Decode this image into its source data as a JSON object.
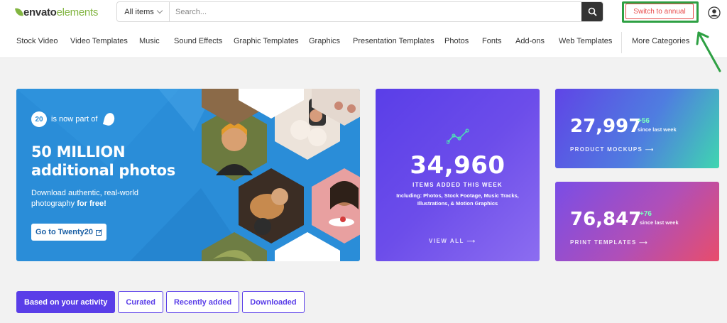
{
  "header": {
    "logo_brand": "envato",
    "logo_brand2": "elements",
    "search_category": "All items",
    "search_placeholder": "Search...",
    "annual_button": "Switch to annual"
  },
  "nav": {
    "items": [
      "Stock Video",
      "Video Templates",
      "Music",
      "Sound Effects",
      "Graphic Templates",
      "Graphics",
      "Presentation Templates",
      "Photos",
      "Fonts",
      "Add-ons",
      "Web Templates"
    ],
    "more": "More Categories"
  },
  "hero": {
    "badge": "20",
    "badge_text": "is now part of",
    "title_line1": "50 MILLION",
    "title_line2": "additional photos",
    "desc_line1": "Download authentic, real-world",
    "desc_line2": "photography",
    "desc_bold": "for free!",
    "cta": "Go to Twenty20"
  },
  "items_card": {
    "number": "34,960",
    "label": "ITEMS ADDED THIS WEEK",
    "sub": "Including: Photos, Stock Footage, Music Tracks, Illustrations, & Motion Graphics",
    "view_all": "VIEW ALL"
  },
  "stats": [
    {
      "number": "27,997",
      "delta": "+56",
      "since": "since last week",
      "caption": "PRODUCT MOCKUPS"
    },
    {
      "number": "76,847",
      "delta": "+76",
      "since": "since last week",
      "caption": "PRINT TEMPLATES"
    }
  ],
  "tabs": [
    "Based on your activity",
    "Curated",
    "Recently added",
    "Downloaded"
  ],
  "colors": {
    "accent": "#5a3ee8",
    "brand_green": "#82b541",
    "annotation_green": "#2ea043",
    "annual_red": "#e74c4c"
  },
  "icons": [
    "search-icon",
    "user-icon",
    "chevron-down-icon",
    "trend-icon",
    "external-link-icon",
    "arrow-right-icon"
  ]
}
